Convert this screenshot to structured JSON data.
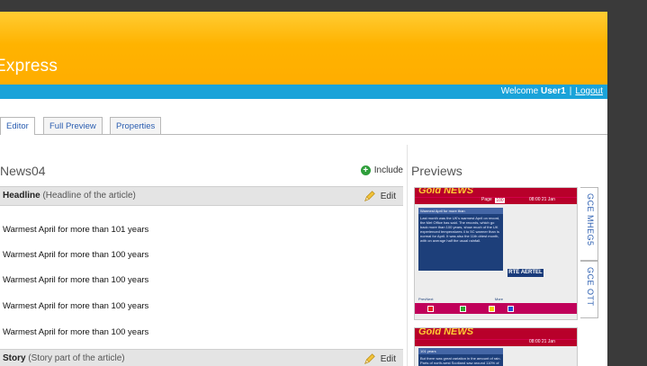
{
  "app": {
    "title": "Express",
    "welcome_prefix": "Welcome",
    "user": "User1",
    "separator": "|",
    "logout": "Logout"
  },
  "tabs": [
    {
      "label": "Editor"
    },
    {
      "label": "Full Preview"
    },
    {
      "label": "Properties"
    }
  ],
  "editor": {
    "title": "News04",
    "include_label": "Include",
    "headline": {
      "name": "Headline",
      "desc": "(Headline of the article)",
      "edit_label": "Edit",
      "values": [
        "Warmest April for more than 101 years",
        "Warmest April for more than 100 years",
        "Warmest April for more than 100 years",
        "Warmest April for more than 100 years",
        "Warmest April for more than 100 years"
      ]
    },
    "story": {
      "name": "Story",
      "desc": "(Story part of the article)",
      "edit_label": "Edit"
    }
  },
  "previews": {
    "title": "Previews",
    "vtabs": [
      {
        "label": "GCE MHEG5"
      },
      {
        "label": "GCE OTT"
      }
    ],
    "thumb1": {
      "brand": "Gold NEWS",
      "page_label": "Page",
      "page_num": "100",
      "time": "08:00 21 Jan",
      "headline": "Warmest April for more than",
      "body": "Last month was the UK's warmest April on record, the Met Office has said. The records, which go back more than 100 years, show much of the UK experienced temperatures 4 to 5C warmer than is normal for April. It was also the 11th driest month, with on average half the usual rainfall.",
      "logo": "RTÉ AERTEL",
      "prev": "PrevNext",
      "more": "More"
    },
    "thumb2": {
      "brand": "Gold NEWS",
      "headline": "101 years",
      "body": "But there was great variation in the amount of rain. Parts of north-west Scotland saw around 110% of normal rainfall while much of"
    }
  }
}
